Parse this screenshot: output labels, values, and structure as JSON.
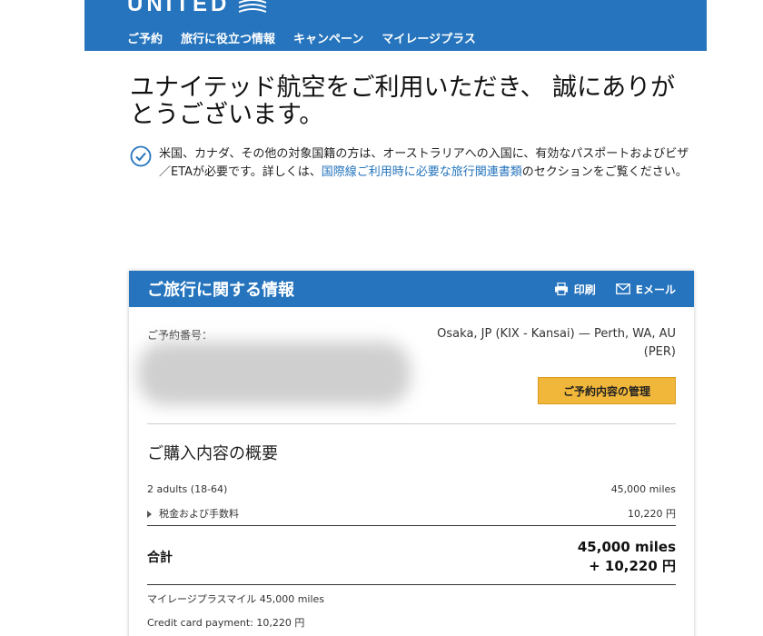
{
  "header": {
    "logo_text": "UNITED",
    "nav": [
      "ご予約",
      "旅行に役立つ情報",
      "キャンペーン",
      "マイレージプラス"
    ],
    "background_color": "#2574bd"
  },
  "page": {
    "title": "ユナイテッド航空をご利用いただき、 誠にありがとうございます。",
    "notice_before": "米国、カナダ、その他の対象国籍の方は、オーストラリアへの入国に、有効なパスポートおよびビザ／ETAが必要です。詳しくは、",
    "notice_link": "国際線ご利用時に必要な旅行関連書類",
    "notice_after": "のセクションをご覧ください。"
  },
  "card": {
    "title": "ご旅行に関する情報",
    "print_label": "印刷",
    "email_label": "Eメール",
    "confirmation_label": "ご予約番号：",
    "route": "Osaka, JP (KIX - Kansai) — Perth, WA, AU (PER)",
    "manage_button": "ご予約内容の管理",
    "summary_title": "ご購入内容の概要",
    "passengers_label": "2 adults (18-64)",
    "passengers_value": "45,000 miles",
    "taxes_label": "税金および手数料",
    "taxes_value": "10,220 円",
    "total_label": "合計",
    "total_miles": "45,000 miles",
    "total_yen": "+ 10,220 円",
    "mileage_payment": "マイレージプラスマイル 45,000 miles",
    "card_payment": "Credit card payment: 10,220 円",
    "button_color": "#f1b73a"
  }
}
